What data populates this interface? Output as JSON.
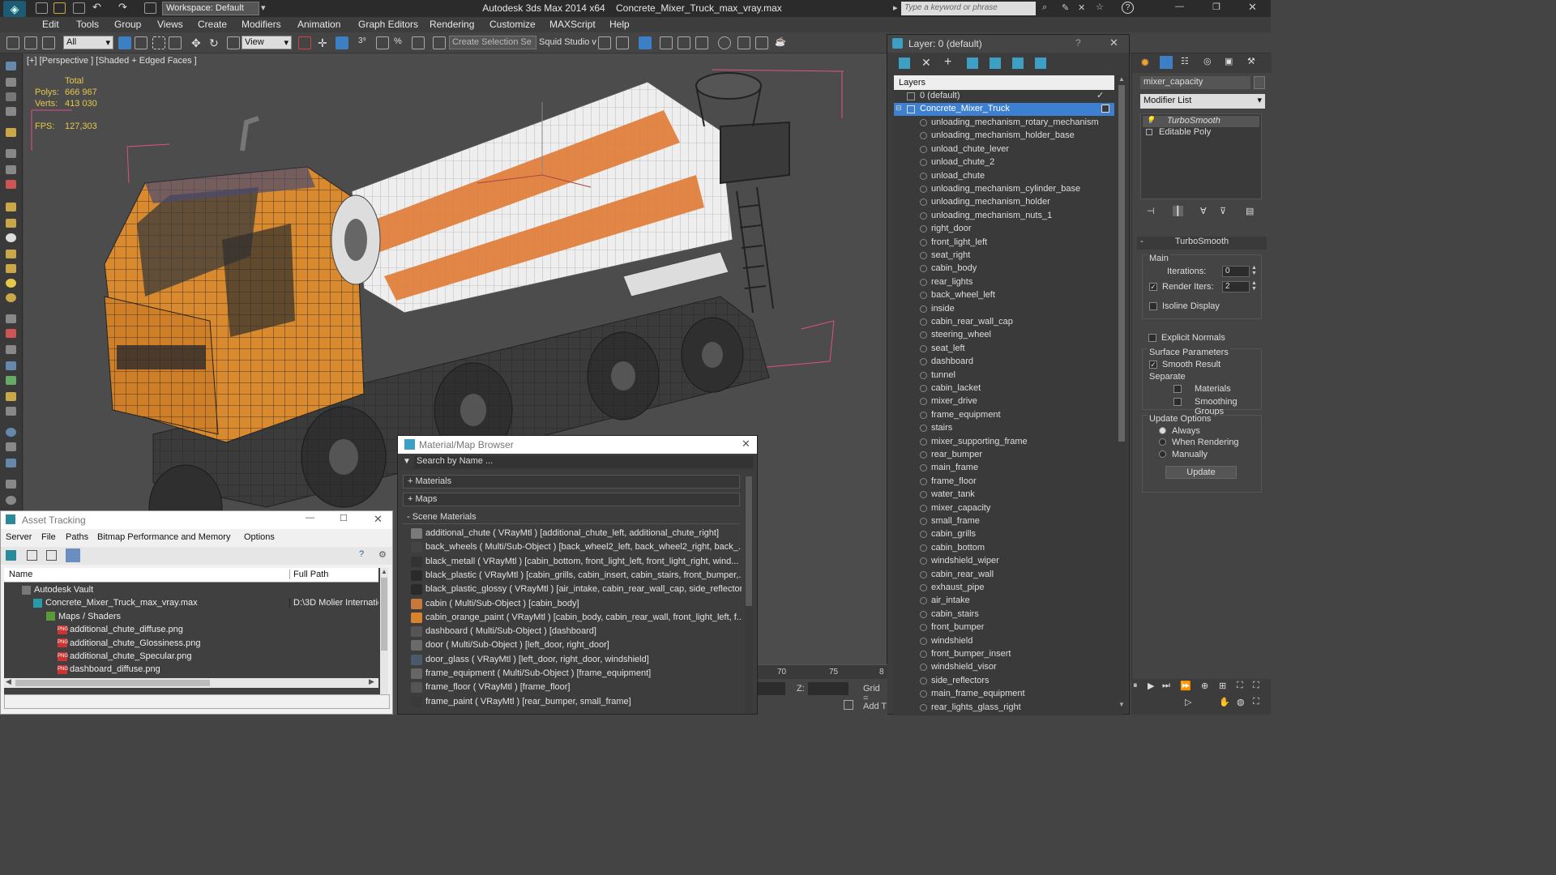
{
  "titlebar": {
    "app_title": "Autodesk 3ds Max  2014 x64",
    "file_title": "Concrete_Mixer_Truck_max_vray.max",
    "workspace": "Workspace: Default",
    "search_placeholder": "Type a keyword or phrase"
  },
  "menu": [
    "Edit",
    "Tools",
    "Group",
    "Views",
    "Create",
    "Modifiers",
    "Animation",
    "Graph Editors",
    "Rendering",
    "Customize",
    "MAXScript",
    "Help"
  ],
  "toolbar": {
    "selection_filter": "All",
    "ref_coord": "View",
    "named_selection": "Create Selection Se",
    "squid": "Squid Studio v"
  },
  "viewport": {
    "label": "[+] [Perspective ] [Shaded + Edged Faces ]",
    "stats": {
      "total_label": "Total",
      "polys_label": "Polys:",
      "polys_value": "666 967",
      "verts_label": "Verts:",
      "verts_value": "413 030",
      "fps_label": "FPS:",
      "fps_value": "127,303"
    },
    "colors": {
      "cabin": "#d9892e",
      "stripe": "#e07a35",
      "drum": "#eeeeee",
      "chassis": "#3a3a3a",
      "bbox": "#e0508a"
    }
  },
  "layers_panel": {
    "title": "Layer: 0 (default)",
    "column_header": "Layers",
    "default_layer": "0 (default)",
    "selected_layer": "Concrete_Mixer_Truck",
    "items": [
      "unloading_mechanism_rotary_mechanism",
      "unloading_mechanism_holder_base",
      "unload_chute_lever",
      "unload_chute_2",
      "unload_chute",
      "unloading_mechanism_cylinder_base",
      "unloading_mechanism_holder",
      "unloading_mechanism_nuts_1",
      "right_door",
      "front_light_left",
      "seat_right",
      "cabin_body",
      "rear_lights",
      "back_wheel_left",
      "inside",
      "cabin_rear_wall_cap",
      "steering_wheel",
      "seat_left",
      "dashboard",
      "tunnel",
      "cabin_lacket",
      "mixer_drive",
      "frame_equipment",
      "stairs",
      "mixer_supporting_frame",
      "rear_bumper",
      "main_frame",
      "frame_floor",
      "water_tank",
      "mixer_capacity",
      "small_frame",
      "cabin_grills",
      "cabin_bottom",
      "windshield_wiper",
      "cabin_rear_wall",
      "exhaust_pipe",
      "air_intake",
      "cabin_stairs",
      "front_bumper",
      "windshield",
      "front_bumper_insert",
      "windshield_visor",
      "side_reflectors",
      "main_frame_equipment",
      "rear_lights_glass_right"
    ]
  },
  "command_panel": {
    "object_name": "mixer_capacity",
    "modifier_list": "Modifier List",
    "stack": [
      "TurboSmooth",
      "Editable Poly"
    ],
    "rollout_title": "TurboSmooth",
    "main_label": "Main",
    "iterations_label": "Iterations:",
    "iterations_value": "0",
    "render_iters_label": "Render Iters:",
    "render_iters_value": "2",
    "isoline_label": "Isoline Display",
    "explicit_normals_label": "Explicit Normals",
    "surface_params_label": "Surface Parameters",
    "smooth_result_label": "Smooth Result",
    "separate_label": "Separate",
    "materials_label": "Materials",
    "smoothing_groups_label": "Smoothing Groups",
    "update_options_label": "Update Options",
    "always_label": "Always",
    "when_rendering_label": "When Rendering",
    "manually_label": "Manually",
    "update_button": "Update"
  },
  "material_browser": {
    "title": "Material/Map Browser",
    "search_placeholder": "Search by Name ...",
    "sections": [
      "+ Materials",
      "+ Maps",
      "- Scene Materials"
    ],
    "items": [
      {
        "text": "additional_chute ( VRayMtl ) [additional_chute_left, additional_chute_right]",
        "color": "#7a7a7a"
      },
      {
        "text": "back_wheels ( Multi/Sub-Object ) [back_wheel2_left, back_wheel2_right, back_...",
        "color": "#444444"
      },
      {
        "text": "black_metall ( VRayMtl ) [cabin_bottom, front_light_left, front_light_right, wind...",
        "color": "#333333"
      },
      {
        "text": "black_plastic ( VRayMtl ) [cabin_grills, cabin_insert, cabin_stairs, front_bumper,...",
        "color": "#2a2a2a"
      },
      {
        "text": "black_plastic_glossy ( VRayMtl ) [air_intake, cabin_rear_wall_cap, side_reflectors]",
        "color": "#2a2a2a"
      },
      {
        "text": "cabin ( Multi/Sub-Object ) [cabin_body]",
        "color": "#c8783a"
      },
      {
        "text": "cabin_orange_paint ( VRayMtl ) [cabin_body, cabin_rear_wall, front_light_left, f...",
        "color": "#d9822e"
      },
      {
        "text": "dashboard ( Multi/Sub-Object ) [dashboard]",
        "color": "#555555"
      },
      {
        "text": "door ( Multi/Sub-Object ) [left_door, right_door]",
        "color": "#6a6a6a"
      },
      {
        "text": "door_glass ( VRayMtl ) [left_door, right_door, windshield]",
        "color": "#4a5a6a"
      },
      {
        "text": "frame_equipment ( Multi/Sub-Object ) [frame_equipment]",
        "color": "#666666"
      },
      {
        "text": "frame_floor ( VRayMtl ) [frame_floor]",
        "color": "#555555"
      },
      {
        "text": "frame_paint ( VRayMtl ) [rear_bumper, small_frame]",
        "color": "#3a3a3a"
      }
    ]
  },
  "asset_tracking": {
    "title": "Asset Tracking",
    "menu": [
      "Server",
      "File",
      "Paths",
      "Bitmap Performance and Memory",
      "Options"
    ],
    "col_name": "Name",
    "col_path": "Full Path",
    "rows": [
      {
        "name": "Autodesk Vault",
        "path": "",
        "indent": 1
      },
      {
        "name": "Concrete_Mixer_Truck_max_vray.max",
        "path": "D:\\3D Molier Internatic",
        "indent": 2
      },
      {
        "name": "Maps / Shaders",
        "path": "",
        "indent": 3
      },
      {
        "name": "additional_chute_diffuse.png",
        "path": "",
        "indent": 4
      },
      {
        "name": "additional_chute_Glossiness.png",
        "path": "",
        "indent": 4
      },
      {
        "name": "additional_chute_Specular.png",
        "path": "",
        "indent": 4
      },
      {
        "name": "dashboard_diffuse.png",
        "path": "",
        "indent": 4
      }
    ]
  },
  "timeline": {
    "ticks": [
      "70",
      "75",
      "8"
    ],
    "z_label": "Z:",
    "grid_label": "Grid =",
    "addtime": "Add T"
  }
}
